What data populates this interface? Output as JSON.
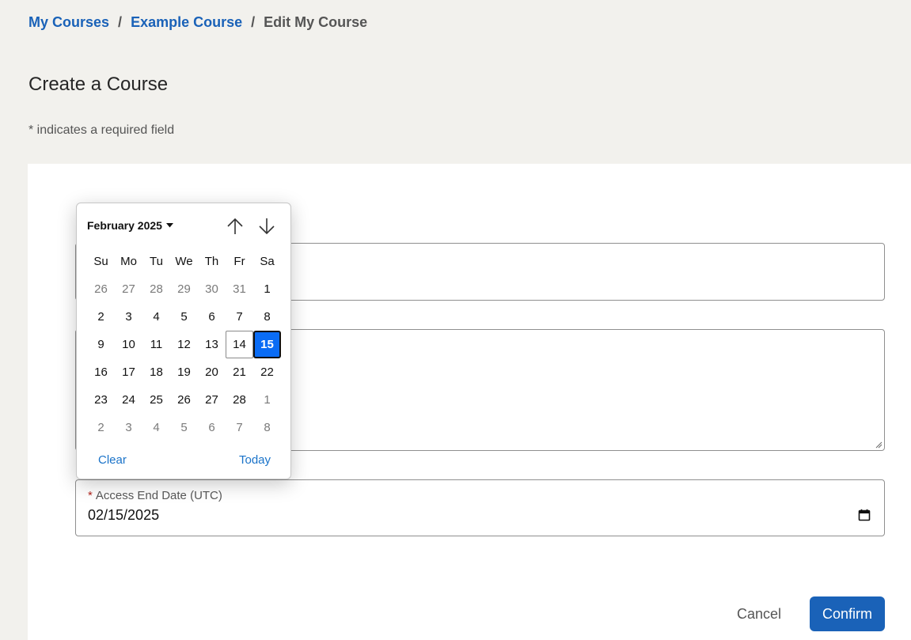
{
  "breadcrumb": {
    "items": [
      "My Courses",
      "Example Course"
    ],
    "separator": "/",
    "current": "Edit My Course"
  },
  "page": {
    "title": "Create a Course",
    "required_note": "* indicates a required field"
  },
  "form": {
    "access_end_date": {
      "required_marker": "*",
      "label": "Access End Date (UTC)",
      "value": "02/15/2025"
    },
    "cancel_label": "Cancel",
    "confirm_label": "Confirm"
  },
  "datepicker": {
    "month_label": "February 2025",
    "weekdays": [
      "Su",
      "Mo",
      "Tu",
      "We",
      "Th",
      "Fr",
      "Sa"
    ],
    "weeks": [
      [
        "26",
        "27",
        "28",
        "29",
        "30",
        "31",
        "1"
      ],
      [
        "2",
        "3",
        "4",
        "5",
        "6",
        "7",
        "8"
      ],
      [
        "9",
        "10",
        "11",
        "12",
        "13",
        "14",
        "15"
      ],
      [
        "16",
        "17",
        "18",
        "19",
        "20",
        "21",
        "22"
      ],
      [
        "23",
        "24",
        "25",
        "26",
        "27",
        "28",
        "1"
      ],
      [
        "2",
        "3",
        "4",
        "5",
        "6",
        "7",
        "8"
      ]
    ],
    "today_day": "14",
    "selected_day": "15",
    "clear_label": "Clear",
    "today_label": "Today"
  },
  "colors": {
    "link": "#1a62b8",
    "primary": "#1a62b8",
    "selected": "#0a6cf5",
    "background": "#f2f1ed"
  }
}
